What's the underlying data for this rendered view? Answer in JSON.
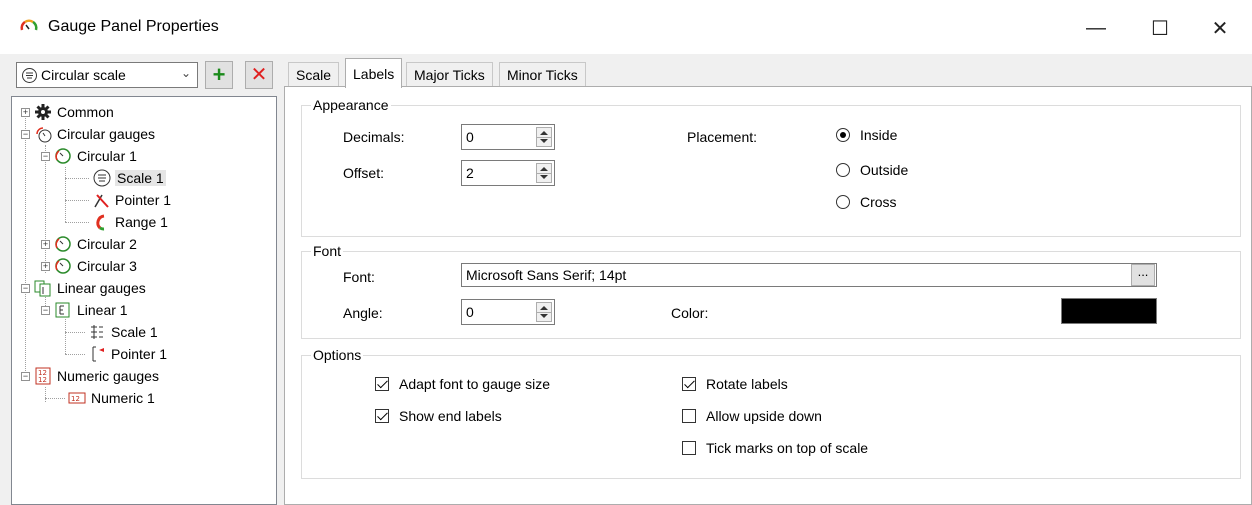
{
  "window": {
    "title": "Gauge Panel Properties",
    "minimize_glyph": "—",
    "maximize_glyph": "☐",
    "close_glyph": "✕"
  },
  "toolbar": {
    "scale_select_value": "Circular scale",
    "add_glyph": "+",
    "remove_glyph": "✕",
    "add_color": "#1a8a1a",
    "remove_color": "#e02020"
  },
  "tree": {
    "common": "Common",
    "circular_gauges": "Circular gauges",
    "circular_1": "Circular 1",
    "scale_1": "Scale 1",
    "pointer_1": "Pointer 1",
    "range_1": "Range 1",
    "circular_2": "Circular 2",
    "circular_3": "Circular 3",
    "linear_gauges": "Linear gauges",
    "linear_1": "Linear 1",
    "linear_scale_1": "Scale 1",
    "linear_pointer_1": "Pointer 1",
    "numeric_gauges": "Numeric gauges",
    "numeric_1": "Numeric 1"
  },
  "tabs": [
    "Scale",
    "Labels",
    "Major Ticks",
    "Minor Ticks"
  ],
  "active_tab": "Labels",
  "appearance": {
    "title": "Appearance",
    "decimals_label": "Decimals:",
    "decimals_value": "0",
    "offset_label": "Offset:",
    "offset_value": "2",
    "placement_label": "Placement:",
    "placement_options": [
      "Inside",
      "Outside",
      "Cross"
    ],
    "placement_selected": "Inside"
  },
  "font_group": {
    "title": "Font",
    "font_label": "Font:",
    "font_value": "Microsoft Sans Serif; 14pt",
    "font_button": "...",
    "angle_label": "Angle:",
    "angle_value": "0",
    "color_label": "Color:",
    "color_value": "#000000"
  },
  "options": {
    "title": "Options",
    "adapt_font": "Adapt font to gauge size",
    "show_end_labels": "Show end labels",
    "rotate_labels": "Rotate labels",
    "allow_upside_down": "Allow upside down",
    "tick_marks_on_top": "Tick marks on top of scale",
    "adapt_font_checked": true,
    "show_end_labels_checked": true,
    "rotate_labels_checked": true,
    "allow_upside_down_checked": false,
    "tick_marks_on_top_checked": false
  }
}
